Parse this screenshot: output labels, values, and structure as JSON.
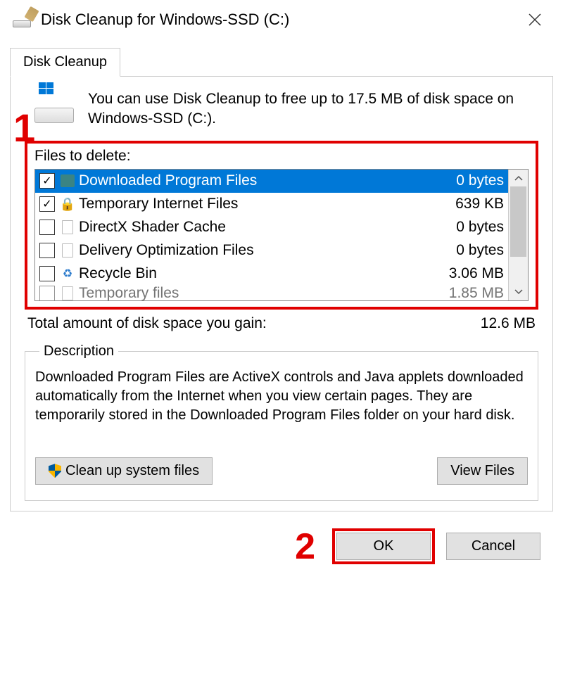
{
  "window": {
    "title": "Disk Cleanup for Windows-SSD (C:)"
  },
  "tab": {
    "label": "Disk Cleanup"
  },
  "intro": "You can use Disk Cleanup to free up to 17.5 MB of disk space on Windows-SSD (C:).",
  "files_label": "Files to delete:",
  "files": [
    {
      "checked": true,
      "icon": "folder",
      "name": "Downloaded Program Files",
      "size": "0 bytes",
      "selected": true
    },
    {
      "checked": true,
      "icon": "lock",
      "name": "Temporary Internet Files",
      "size": "639 KB",
      "selected": false
    },
    {
      "checked": false,
      "icon": "file",
      "name": "DirectX Shader Cache",
      "size": "0 bytes",
      "selected": false
    },
    {
      "checked": false,
      "icon": "file",
      "name": "Delivery Optimization Files",
      "size": "0 bytes",
      "selected": false
    },
    {
      "checked": false,
      "icon": "recycle",
      "name": "Recycle Bin",
      "size": "3.06 MB",
      "selected": false
    },
    {
      "checked": false,
      "icon": "file",
      "name": "Temporary files",
      "size": "1.85 MB",
      "selected": false,
      "partial": true
    }
  ],
  "total": {
    "label": "Total amount of disk space you gain:",
    "value": "12.6 MB"
  },
  "description": {
    "legend": "Description",
    "text": "Downloaded Program Files are ActiveX controls and Java applets downloaded automatically from the Internet when you view certain pages. They are temporarily stored in the Downloaded Program Files folder on your hard disk."
  },
  "buttons": {
    "cleanup_system": "Clean up system files",
    "view_files": "View Files",
    "ok": "OK",
    "cancel": "Cancel"
  },
  "annotations": {
    "one": "1",
    "two": "2"
  }
}
